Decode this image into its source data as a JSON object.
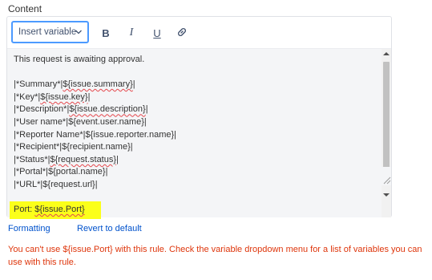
{
  "field": {
    "label": "Content"
  },
  "toolbar": {
    "insert_variable_label": "Insert variable",
    "bold_label": "B",
    "italic_label": "I",
    "underline_label": "U",
    "icons": {
      "dropdown": "chevron-down-icon",
      "link": "link-icon"
    }
  },
  "editor": {
    "intro": "This request is awaiting approval.",
    "rows": [
      {
        "prefix": "|*Summary*|",
        "var": "${issue.summary}",
        "suffix": "|",
        "flagged": true
      },
      {
        "prefix": "|*Key*|",
        "var": "${issue.key}",
        "suffix": "|",
        "flagged": true
      },
      {
        "prefix": "|*Description*|",
        "var": "${issue.description}",
        "suffix": "|",
        "flagged": true
      },
      {
        "prefix": "|*User name*|",
        "var": "${event.user.name}",
        "suffix": "|",
        "flagged": false
      },
      {
        "prefix": "|*Reporter Name*|",
        "var": "${issue.reporter.name}",
        "suffix": "|",
        "flagged": false
      },
      {
        "prefix": "|*Recipient*|",
        "var": "${recipient.name}",
        "suffix": "|",
        "flagged": false
      },
      {
        "prefix": "|*Status*|",
        "var": "${request.status}",
        "suffix": "|",
        "flagged": true
      },
      {
        "prefix": "|*Portal*|",
        "var": "${portal.name}",
        "suffix": "|",
        "flagged": false
      },
      {
        "prefix": "|*URL*|",
        "var": "${request.url}",
        "suffix": "|",
        "flagged": false
      }
    ],
    "port_prefix": "Port: ",
    "port_var": "${issue.Port}",
    "highlight_color": "#fbff1a"
  },
  "links": {
    "formatting": "Formatting",
    "revert": "Revert to default"
  },
  "error": {
    "message": "You can't use ${issue.Port} with this rule. Check the variable dropdown menu for a list of variables you can use with this rule.",
    "color": "#de350b"
  }
}
